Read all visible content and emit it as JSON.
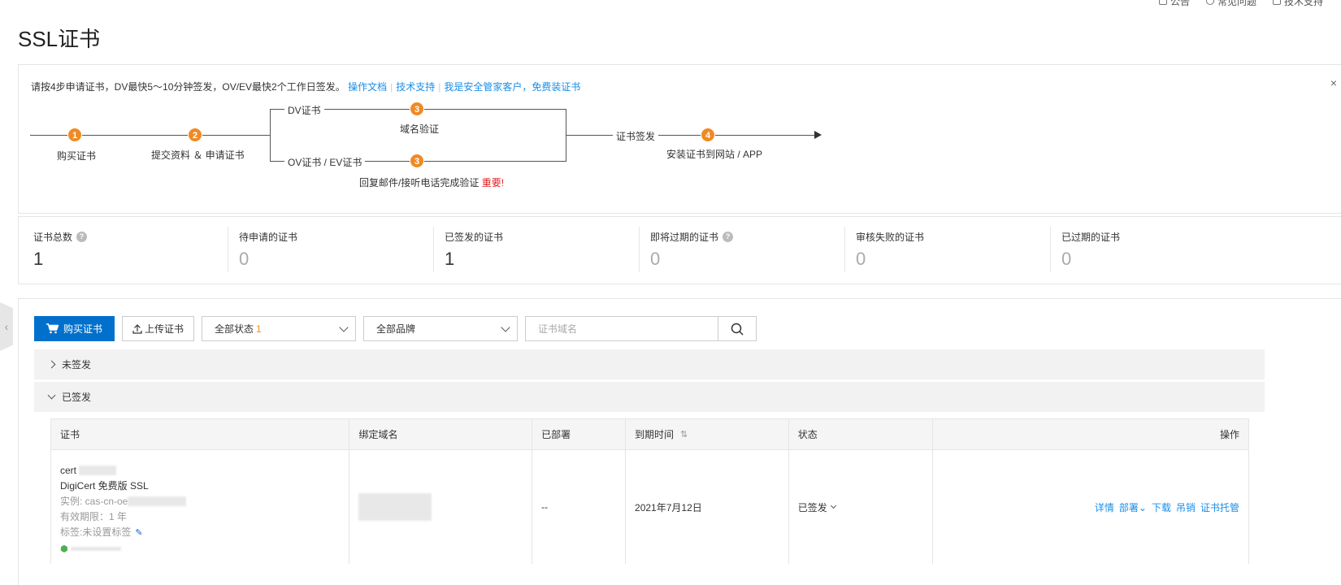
{
  "topbar": {
    "items": [
      {
        "label": "公告",
        "icon": "announcement-icon"
      },
      {
        "label": "常见问题",
        "icon": "help-circle-icon"
      },
      {
        "label": "技术支持",
        "icon": "support-icon"
      }
    ]
  },
  "page": {
    "title": "SSL证书"
  },
  "guide": {
    "intro": "请按4步申请证书，DV最快5～10分钟签发，OV/EV最快2个工作日签发。",
    "links": [
      "操作文档",
      "技术支持",
      "我是安全管家客户，免费装证书"
    ],
    "steps": {
      "s1": {
        "num": "1",
        "label": "购买证书"
      },
      "s2": {
        "num": "2",
        "label": "提交资料 ＆ 申请证书"
      },
      "dv": {
        "branch": "DV证书",
        "num": "3",
        "label": "域名验证"
      },
      "ov": {
        "branch": "OV证书 / EV证书",
        "num": "3",
        "label": "回复邮件/接听电话完成验证",
        "important": "重要!"
      },
      "issue": "证书签发",
      "s4": {
        "num": "4",
        "label": "安装证书到网站 / APP"
      }
    }
  },
  "stats": [
    {
      "label": "证书总数",
      "value": "1",
      "help": true
    },
    {
      "label": "待申请的证书",
      "value": "0",
      "help": false
    },
    {
      "label": "已签发的证书",
      "value": "1",
      "help": false
    },
    {
      "label": "即将过期的证书",
      "value": "0",
      "help": true
    },
    {
      "label": "审核失败的证书",
      "value": "0",
      "help": false
    },
    {
      "label": "已过期的证书",
      "value": "0",
      "help": false
    }
  ],
  "toolbar": {
    "buy_label": "购买证书",
    "upload_label": "上传证书",
    "status_filter": {
      "label": "全部状态",
      "count": "1"
    },
    "brand_filter": {
      "label": "全部品牌"
    },
    "search_placeholder": "证书域名"
  },
  "groups": {
    "unissued": "未签发",
    "issued": "已签发"
  },
  "table": {
    "columns": [
      "证书",
      "绑定域名",
      "已部署",
      "到期时间",
      "状态",
      "操作"
    ],
    "rows": [
      {
        "cert_name_prefix": "cert",
        "product": "DigiCert 免费版 SSL",
        "instance_prefix": "实例: cas-cn-oe",
        "validity": "有效期限：1 年",
        "tags": "标签:未设置标签",
        "deployed": "--",
        "expiry": "2021年7月12日",
        "status": "已签发",
        "actions": [
          "详情",
          "部署",
          "下载",
          "吊销",
          "证书托管"
        ]
      }
    ]
  },
  "colors": {
    "primary": "#0070cc",
    "link": "#1a8ee8",
    "step": "#f08a24",
    "important": "#e02020"
  }
}
